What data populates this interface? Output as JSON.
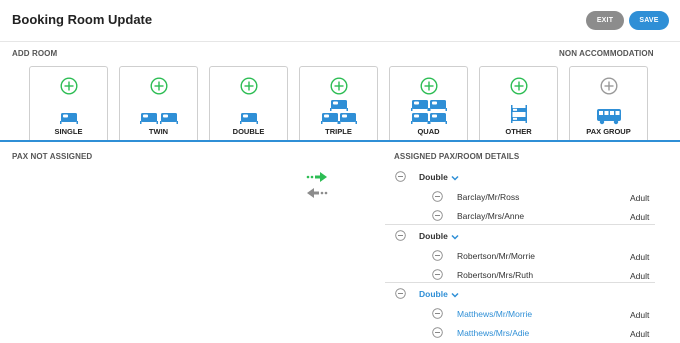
{
  "header": {
    "title": "Booking Room Update",
    "exit_label": "EXIT",
    "save_label": "SAVE"
  },
  "add_room": {
    "label": "ADD ROOM",
    "non_accommodation_label": "NON ACCOMMODATION",
    "tiles": [
      {
        "label": "SINGLE",
        "icon": "single-bed-icon",
        "enabled": true
      },
      {
        "label": "TWIN",
        "icon": "twin-beds-icon",
        "enabled": true
      },
      {
        "label": "DOUBLE",
        "icon": "double-bed-icon",
        "enabled": true
      },
      {
        "label": "TRIPLE",
        "icon": "triple-beds-icon",
        "enabled": true
      },
      {
        "label": "QUAD",
        "icon": "quad-beds-icon",
        "enabled": true
      },
      {
        "label": "OTHER",
        "icon": "bunk-bed-icon",
        "enabled": true
      },
      {
        "label": "PAX GROUP",
        "icon": "bus-icon",
        "enabled": false
      }
    ]
  },
  "pax_not_assigned": {
    "label": "PAX NOT ASSIGNED"
  },
  "assigned": {
    "label": "ASSIGNED PAX/ROOM DETAILS",
    "groups": [
      {
        "room": "Double",
        "highlighted": false,
        "pax": [
          {
            "name": "Barclay/Mr/Ross",
            "type": "Adult"
          },
          {
            "name": "Barclay/Mrs/Anne",
            "type": "Adult"
          }
        ]
      },
      {
        "room": "Double",
        "highlighted": false,
        "pax": [
          {
            "name": "Robertson/Mr/Morrie",
            "type": "Adult"
          },
          {
            "name": "Robertson/Mrs/Ruth",
            "type": "Adult"
          }
        ]
      },
      {
        "room": "Double",
        "highlighted": true,
        "pax": [
          {
            "name": "Matthews/Mr/Morrie",
            "type": "Adult"
          },
          {
            "name": "Matthews/Mrs/Adie",
            "type": "Adult"
          }
        ]
      }
    ]
  },
  "colors": {
    "accent": "#2f8fd6",
    "green": "#2dbd54",
    "grey": "#8c8c8c"
  }
}
